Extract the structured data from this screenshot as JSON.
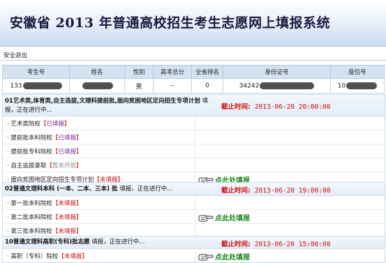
{
  "header": {
    "title": "安徽省 2013 年普通高校招生考生志愿网上填报系统"
  },
  "logout": "安全退出",
  "info_table": {
    "headers": [
      "考生号",
      "姓名",
      "性别",
      "高考总分",
      "全省排名",
      "身份证号",
      "座位号"
    ],
    "values": [
      "133",
      "",
      "男",
      "--",
      "0",
      "34242",
      "10"
    ]
  },
  "sections": [
    {
      "title_bold": "01艺术类,体育类,自主选拔,文理科提前批,面向贫困地区定向招生专项计划",
      "title_rest": " 填报，正在进行中...",
      "deadline_label": "截止时间:",
      "deadline": "2013-06-20  20:00:00",
      "items": [
        {
          "name": "艺术类院校",
          "status": "已填报",
          "type": "ok"
        },
        {
          "name": "提前批本科院校",
          "status": "已填报",
          "type": "ok"
        },
        {
          "name": "提前批专科院校",
          "status": "已填报",
          "type": "ok"
        },
        {
          "name": "自主选拔录取",
          "status": "暂未开放",
          "type": "na"
        },
        {
          "name": "面向贫困地区定向招生专项计划",
          "status": "未填报",
          "type": "no"
        }
      ],
      "fill_label": "点此处填报"
    },
    {
      "title_bold": "02普通文理科本科 (一本、二本、三本) 批",
      "title_rest": " 填报，正在进行中...",
      "deadline_label": "截止时间:",
      "deadline": "2013-06-20  19:00:00",
      "items": [
        {
          "name": "第一批本科院校",
          "status": "未填报",
          "type": "no"
        },
        {
          "name": "第二批本科院校",
          "status": "未填报",
          "type": "no"
        },
        {
          "name": "第三批本科院校",
          "status": "未填报",
          "type": "no"
        }
      ],
      "fill_label": "点此处填报"
    },
    {
      "title_bold": "10普通文理科高职(专科)批志愿",
      "title_rest": " 填报，正在进行中...",
      "deadline_label": "截止时间:",
      "deadline": "2013-06-20  15:00:00",
      "items": [
        {
          "name": "高职（专科）院校",
          "status": "未填报",
          "type": "no"
        }
      ],
      "fill_label": "点此处填报"
    }
  ]
}
